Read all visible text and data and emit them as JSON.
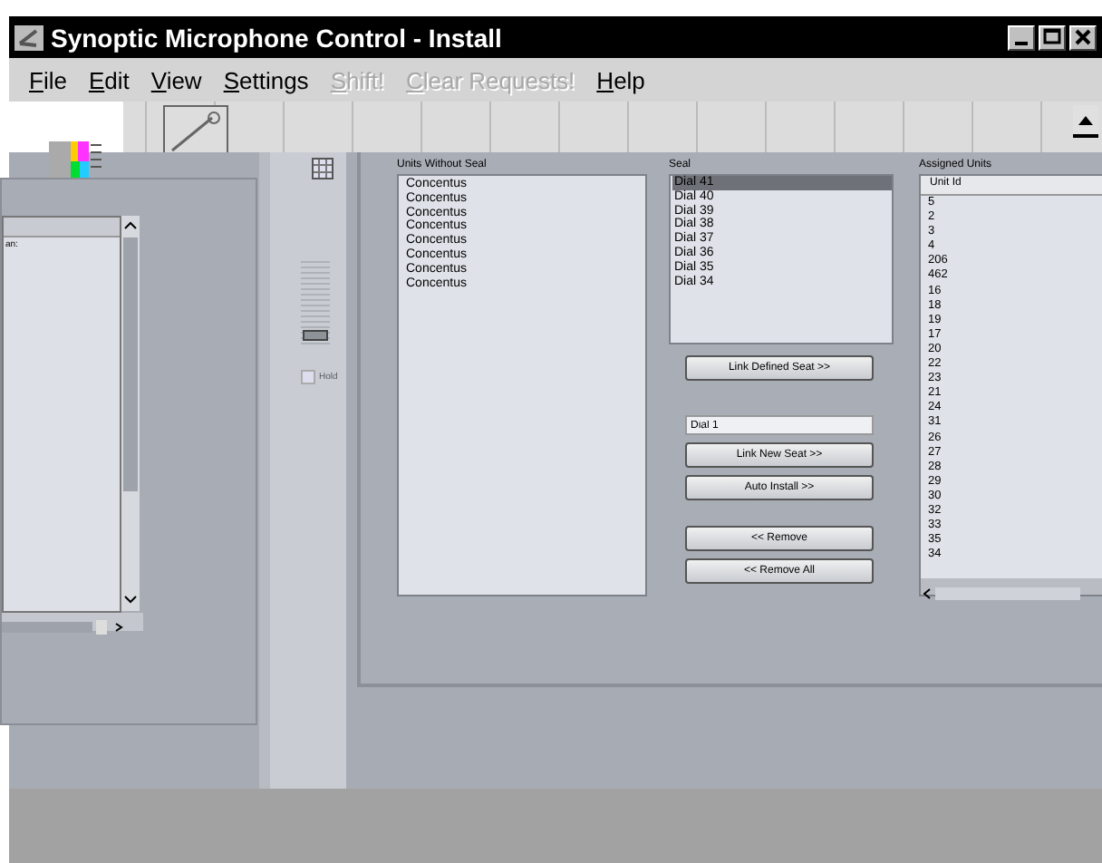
{
  "window": {
    "title": "Synoptic Microphone Control - Install"
  },
  "menu": [
    {
      "label": "File",
      "disabled": false
    },
    {
      "label": "Edit",
      "disabled": false
    },
    {
      "label": "View",
      "disabled": false
    },
    {
      "label": "Settings",
      "disabled": false
    },
    {
      "label": "Shift!",
      "disabled": true
    },
    {
      "label": "Clear Requests!",
      "disabled": true
    },
    {
      "label": "Help",
      "disabled": false
    }
  ],
  "left_panel": {
    "list_text": "an:"
  },
  "mixer": {
    "level": 0.08,
    "checkbox": {
      "label": "Hold",
      "checked": false
    }
  },
  "units_without_seal": {
    "label": "Units Without Seal",
    "items": [
      "Concentus",
      "Concentus",
      "Concentus",
      "Concentus",
      "Concentus",
      "Concentus",
      "Concentus",
      "Concentus"
    ]
  },
  "seal": {
    "label": "Seal",
    "items": [
      {
        "label": "Dial 41",
        "selected": true
      },
      {
        "label": "Dial 40",
        "selected": false
      },
      {
        "label": "Dial 39",
        "selected": false
      },
      {
        "label": "Dial 38",
        "selected": false
      },
      {
        "label": "Dial 37",
        "selected": false
      },
      {
        "label": "Dial 36",
        "selected": false
      },
      {
        "label": "Dial 35",
        "selected": false
      },
      {
        "label": "Dial 34",
        "selected": false
      }
    ]
  },
  "link_defined_button": "Link Defined Seat >>",
  "new_seat_field": {
    "value": "Dial 1"
  },
  "action_button_groups": [
    [
      "Link New Seat >>",
      "Auto Install >>"
    ],
    [
      "<< Remove",
      "<< Remove All"
    ]
  ],
  "assigned_units": {
    "label": "Assigned Units",
    "columns": [
      "Unit Id"
    ],
    "rows": [
      "5",
      "2",
      "3",
      "4",
      "206",
      "462",
      "16",
      "18",
      "19",
      "17",
      "20",
      "22",
      "23",
      "21",
      "24",
      "31",
      "26",
      "27",
      "28",
      "29",
      "30",
      "32",
      "33",
      "35",
      "34"
    ]
  }
}
